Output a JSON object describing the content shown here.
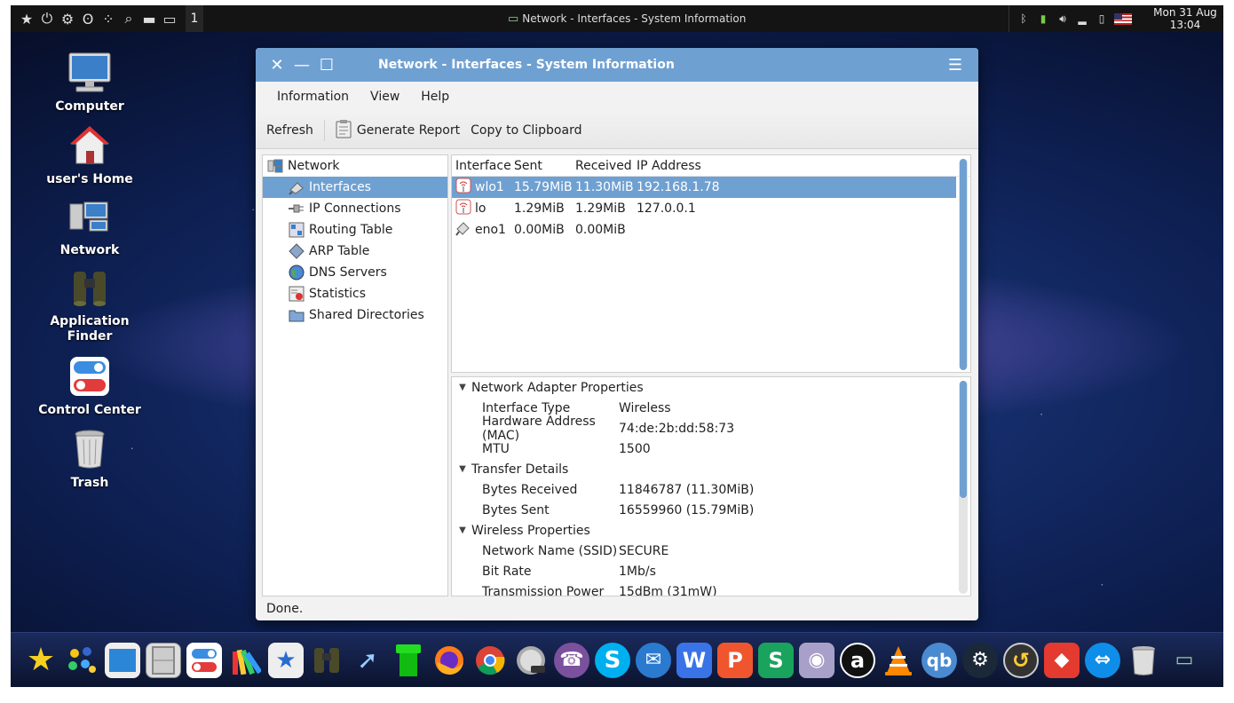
{
  "top_panel": {
    "workspace": "1",
    "active_task": "Network - Interfaces - System Information",
    "clock": {
      "date": "Mon 31 Aug",
      "time": "13:04"
    }
  },
  "desktop_icons": [
    {
      "label": "Computer",
      "icon": "computer-icon"
    },
    {
      "label": "user's Home",
      "icon": "home-icon"
    },
    {
      "label": "Network",
      "icon": "network-icon"
    },
    {
      "label": "Application Finder",
      "icon": "binoculars-icon"
    },
    {
      "label": "Control Center",
      "icon": "toggles-icon"
    },
    {
      "label": "Trash",
      "icon": "trash-icon"
    }
  ],
  "window": {
    "title": "Network - Interfaces - System Information",
    "menu": [
      "Information",
      "View",
      "Help"
    ],
    "toolbar": {
      "refresh": "Refresh",
      "generate_report": "Generate Report",
      "copy_clipboard": "Copy to Clipboard"
    },
    "tree": {
      "root": "Network",
      "items": [
        "Interfaces",
        "IP Connections",
        "Routing Table",
        "ARP Table",
        "DNS Servers",
        "Statistics",
        "Shared Directories"
      ]
    },
    "interfaces": {
      "columns": [
        "Interface",
        "Sent",
        "Received",
        "IP Address"
      ],
      "rows": [
        {
          "name": "wlo1",
          "sent": "15.79MiB",
          "received": "11.30MiB",
          "ip": "192.168.1.78",
          "icon": "wireless-icon"
        },
        {
          "name": "lo",
          "sent": "1.29MiB",
          "received": "1.29MiB",
          "ip": "127.0.0.1",
          "icon": "wireless-icon"
        },
        {
          "name": "eno1",
          "sent": "0.00MiB",
          "received": "0.00MiB",
          "ip": "",
          "icon": "ethernet-icon"
        }
      ]
    },
    "details": {
      "sections": [
        {
          "title": "Network Adapter Properties",
          "rows": [
            [
              "Interface Type",
              "Wireless"
            ],
            [
              "Hardware Address (MAC)",
              "74:de:2b:dd:58:73"
            ],
            [
              "MTU",
              "1500"
            ]
          ]
        },
        {
          "title": "Transfer Details",
          "rows": [
            [
              "Bytes Received",
              "11846787 (11.30MiB)"
            ],
            [
              "Bytes Sent",
              "16559960 (15.79MiB)"
            ]
          ]
        },
        {
          "title": "Wireless Properties",
          "rows": [
            [
              "Network Name (SSID)",
              "SECURE"
            ],
            [
              "Bit Rate",
              "1Mb/s"
            ],
            [
              "Transmission Power",
              "15dBm (31mW)"
            ]
          ]
        }
      ]
    },
    "status": "Done."
  },
  "dock": [
    "favorites-star-icon",
    "apps-grid-icon",
    "desktop-icon",
    "file-cabinet-icon",
    "control-center-icon",
    "appearance-icon",
    "software-center-icon",
    "app-finder-icon",
    "rocket-icon",
    "green-pipe-icon",
    "firefox-icon",
    "chrome-icon",
    "google-earth-icon",
    "viber-icon",
    "skype-icon",
    "mail-icon",
    "wps-writer-icon",
    "wps-presentation-icon",
    "wps-spreadsheet-icon",
    "webcam-icon",
    "amazon-icon",
    "vlc-icon",
    "qbittorrent-icon",
    "steam-icon",
    "timeshift-icon",
    "anydesk-icon",
    "teamviewer-icon",
    "dock-trash-icon",
    "network-manager-icon"
  ]
}
